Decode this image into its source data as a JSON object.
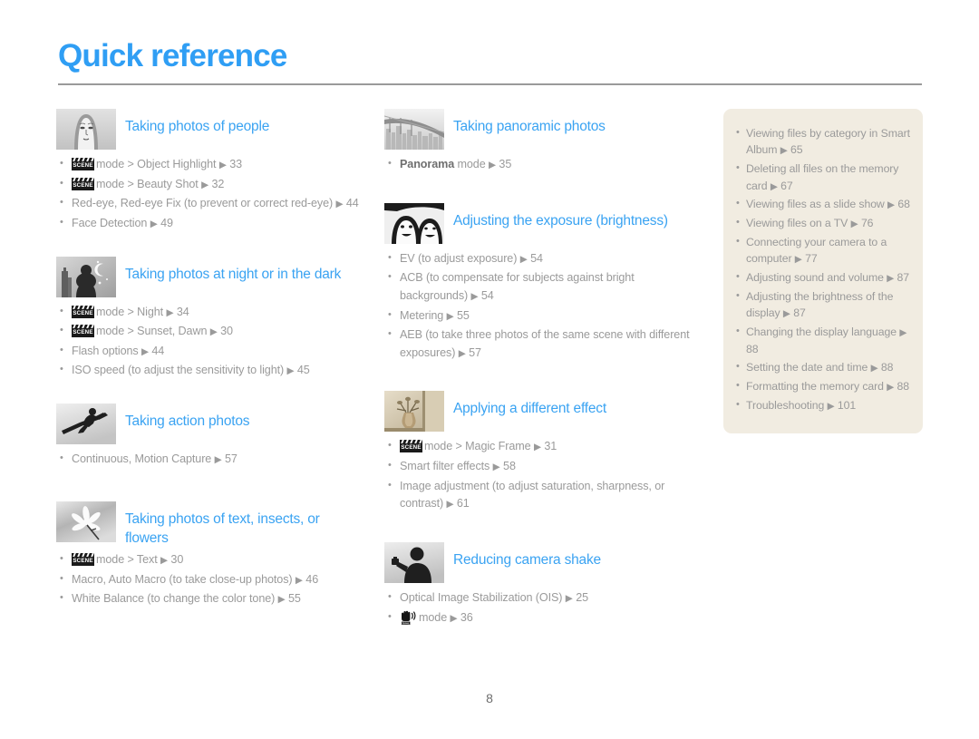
{
  "page": {
    "title": "Quick reference",
    "number": "8",
    "accent_color": "#3aa3f2",
    "text_color": "#9a9a9a",
    "sidebar_bg": "#f1ece1"
  },
  "icons": {
    "scene_label": "SCENE",
    "dual_label": "DUAL",
    "arrow": "▶"
  },
  "left_column": [
    {
      "thumb": "portrait-woman-thumbnail",
      "title": "Taking photos of people",
      "items": [
        {
          "icon": "scene",
          "text": "mode > Object Highlight",
          "page": "33"
        },
        {
          "icon": "scene",
          "text": "mode > Beauty Shot",
          "page": "32"
        },
        {
          "icon": "none",
          "text": "Red-eye, Red-eye Fix (to prevent or correct red-eye)",
          "page": "44"
        },
        {
          "icon": "none",
          "text": "Face Detection",
          "page": "49"
        }
      ]
    },
    {
      "thumb": "night-silhouette-thumbnail",
      "title": "Taking photos at night or in the dark",
      "items": [
        {
          "icon": "scene",
          "text": "mode > Night",
          "page": "34"
        },
        {
          "icon": "scene",
          "text": "mode > Sunset, Dawn",
          "page": "30"
        },
        {
          "icon": "none",
          "text": "Flash options",
          "page": "44"
        },
        {
          "icon": "none",
          "text": "ISO speed (to adjust the sensitivity to light)",
          "page": "45"
        }
      ]
    },
    {
      "thumb": "snowboarder-action-thumbnail",
      "title": "Taking action photos",
      "items": [
        {
          "icon": "none",
          "text": "Continuous, Motion Capture",
          "page": "57"
        }
      ]
    },
    {
      "thumb": "flower-macro-thumbnail",
      "title": "Taking photos of text, insects, or flowers",
      "items": [
        {
          "icon": "scene",
          "text": "mode > Text",
          "page": "30"
        },
        {
          "icon": "none",
          "text": "Macro, Auto Macro (to take close-up photos)",
          "page": "46"
        },
        {
          "icon": "none",
          "text": "White Balance (to change the color tone)",
          "page": "55"
        }
      ]
    }
  ],
  "middle_column": [
    {
      "thumb": "bridge-panorama-thumbnail",
      "title": "Taking panoramic photos",
      "items": [
        {
          "icon": "none",
          "bold_prefix": "Panorama",
          "text": "mode",
          "page": "35"
        }
      ]
    },
    {
      "thumb": "two-faces-exposure-thumbnail",
      "title": "Adjusting the exposure (brightness)",
      "items": [
        {
          "icon": "none",
          "text": "EV (to adjust exposure)",
          "page": "54"
        },
        {
          "icon": "none",
          "text": "ACB (to compensate for subjects against bright backgrounds)",
          "page": "54"
        },
        {
          "icon": "none",
          "text": "Metering",
          "page": "55"
        },
        {
          "icon": "none",
          "text": "AEB (to take three photos of the same scene with different exposures)",
          "page": "57"
        }
      ]
    },
    {
      "thumb": "vase-effect-thumbnail",
      "title": "Applying a different effect",
      "items": [
        {
          "icon": "scene",
          "text": "mode > Magic Frame",
          "page": "31"
        },
        {
          "icon": "none",
          "text": "Smart filter effects",
          "page": "58"
        },
        {
          "icon": "none",
          "text": "Image adjustment (to adjust saturation, sharpness, or contrast)",
          "page": "61"
        }
      ]
    },
    {
      "thumb": "camera-shake-thumbnail",
      "title": "Reducing camera shake",
      "items": [
        {
          "icon": "none",
          "text": "Optical Image Stabilization (OIS)",
          "page": "25"
        },
        {
          "icon": "dual",
          "text": "mode",
          "page": "36"
        }
      ]
    }
  ],
  "sidebar_items": [
    {
      "text": "Viewing files by category in Smart Album",
      "page": "65"
    },
    {
      "text": "Deleting all files on the memory card",
      "page": "67"
    },
    {
      "text": "Viewing files as a slide show",
      "page": "68"
    },
    {
      "text": "Viewing files on a TV",
      "page": "76"
    },
    {
      "text": "Connecting your camera to a computer",
      "page": "77"
    },
    {
      "text": "Adjusting sound and volume",
      "page": "87"
    },
    {
      "text": "Adjusting the brightness of the display",
      "page": "87"
    },
    {
      "text": "Changing the display language",
      "page": "88"
    },
    {
      "text": "Setting the date and time",
      "page": "88"
    },
    {
      "text": "Formatting the memory card",
      "page": "88"
    },
    {
      "text": "Troubleshooting",
      "page": "101"
    }
  ]
}
